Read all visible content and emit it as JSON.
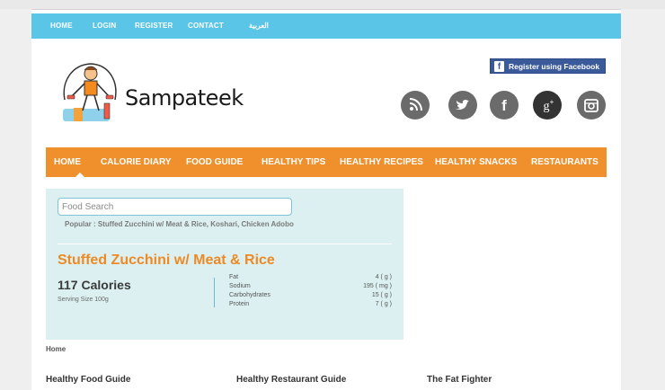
{
  "topnav": {
    "home": "HOME",
    "login": "LOGIN",
    "register": "REGISTER",
    "contact": "CONTACT",
    "arabic": "العربية"
  },
  "brand": {
    "name": "Sampateek"
  },
  "facebook": {
    "label": "Register using Facebook",
    "glyph": "f"
  },
  "social": [
    {
      "icon": "rss-icon",
      "color": "#6b6b6b"
    },
    {
      "icon": "twitter-icon",
      "color": "#6b6b6b"
    },
    {
      "icon": "facebook-icon",
      "color": "#6b6b6b"
    },
    {
      "icon": "google-plus-icon",
      "color": "#333333"
    },
    {
      "icon": "instagram-icon",
      "color": "#6b6b6b"
    }
  ],
  "mainnav": [
    "HOME",
    "CALORIE DIARY",
    "FOOD GUIDE",
    "HEALTHY TIPS",
    "HEALTHY RECIPES",
    "HEALTHY SNACKS",
    "RESTAURANTS"
  ],
  "calorie_widget": {
    "search_placeholder": "Food Search",
    "popular": "Popular : Stuffed Zucchini w/ Meat & Rice, Koshari, Chicken Adobo",
    "food_name": "Stuffed Zucchini w/ Meat & Rice",
    "calories": "117 Calories",
    "serving": "Serving Size 100g",
    "nutrients": [
      {
        "label": "Fat",
        "value": "4 ( g )"
      },
      {
        "label": "Sodium",
        "value": "195 ( mg )"
      },
      {
        "label": "Carbohydrates",
        "value": "15 ( g )"
      },
      {
        "label": "Protein",
        "value": "7 ( g )"
      }
    ]
  },
  "breadcrumb": "Home",
  "guides": [
    "Healthy Food Guide",
    "Healthy Restaurant Guide",
    "The Fat Fighter"
  ],
  "colors": {
    "topbar": "#5bc5e7",
    "nav": "#f0902c",
    "title": "#ee8a24",
    "widget_bg": "#dcf0f1",
    "facebook": "#3b5a9a"
  }
}
